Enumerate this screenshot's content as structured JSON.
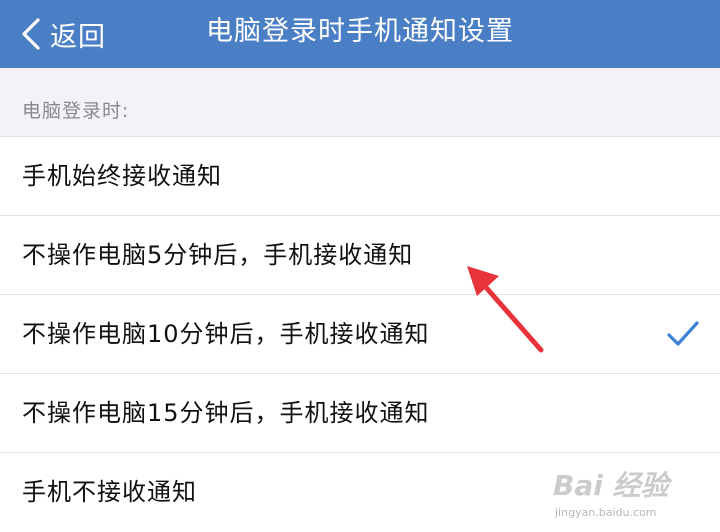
{
  "nav": {
    "back_label": "返回",
    "title": "电脑登录时手机通知设置"
  },
  "section": {
    "label": "电脑登录时:"
  },
  "options": [
    {
      "label": "手机始终接收通知",
      "selected": false
    },
    {
      "label": "不操作电脑5分钟后，手机接收通知",
      "selected": false
    },
    {
      "label": "不操作电脑10分钟后，手机接收通知",
      "selected": true
    },
    {
      "label": "不操作电脑15分钟后，手机接收通知",
      "selected": false
    },
    {
      "label": "手机不接收通知",
      "selected": false
    }
  ],
  "watermark": {
    "brand": "Bai 经验",
    "url": "jingyan.baidu.com"
  },
  "colors": {
    "nav_background": "#4a7fc5",
    "check_color": "#3b82d6",
    "annotation_arrow": "#e8333a"
  }
}
